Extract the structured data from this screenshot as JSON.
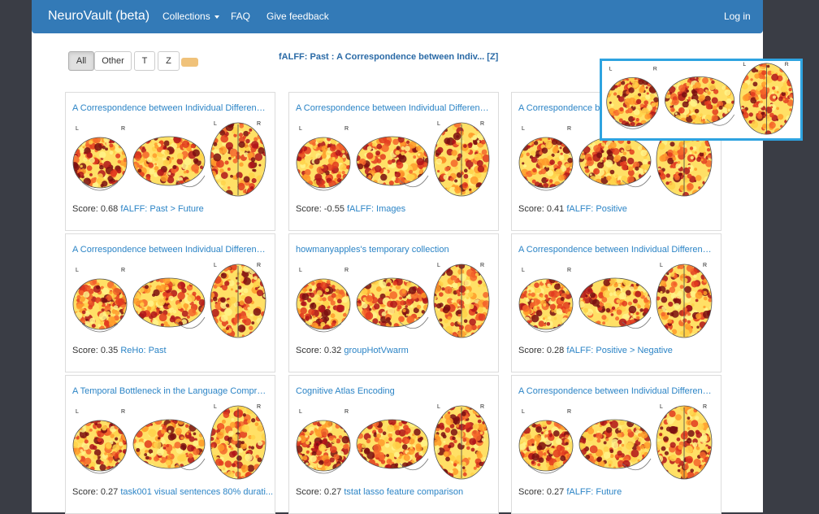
{
  "navbar": {
    "brand": "NeuroVault (beta)",
    "collections": "Collections",
    "faq": "FAQ",
    "feedback": "Give feedback",
    "login": "Log in"
  },
  "filters": {
    "all": "All",
    "other": "Other",
    "t": "T",
    "z": "Z"
  },
  "current_title": "fALFF: Past : A Correspondence between Indiv... [Z]",
  "brain_labels": {
    "left": "L",
    "right": "R"
  },
  "colors": {
    "nav": "#337ab7",
    "link": "#2b84c6",
    "highlight": "#2ea3e0",
    "slider": "#f0c27a"
  },
  "cards": [
    {
      "title": "A Correspondence between Individual Difference...",
      "score_label": "Score:",
      "score": "0.68",
      "map": "fALFF: Past > Future"
    },
    {
      "title": "A Correspondence between Individual Difference...",
      "score_label": "Score:",
      "score": "-0.55",
      "map": "fALFF: Images"
    },
    {
      "title": "A Correspondence between Individual Difference...",
      "score_label": "Score:",
      "score": "0.41",
      "map": "fALFF: Positive"
    },
    {
      "title": "A Correspondence between Individual Difference...",
      "score_label": "Score:",
      "score": "0.35",
      "map": "ReHo: Past"
    },
    {
      "title": "howmanyapples's temporary collection",
      "score_label": "Score:",
      "score": "0.32",
      "map": "groupHotVwarm"
    },
    {
      "title": "A Correspondence between Individual Difference...",
      "score_label": "Score:",
      "score": "0.28",
      "map": "fALFF: Positive > Negative"
    },
    {
      "title": "A Temporal Bottleneck in the Language Compreh...",
      "score_label": "Score:",
      "score": "0.27",
      "map": "task001 visual sentences 80% durati..."
    },
    {
      "title": "Cognitive Atlas Encoding",
      "score_label": "Score:",
      "score": "0.27",
      "map": "tstat lasso feature comparison"
    },
    {
      "title": "A Correspondence between Individual Difference...",
      "score_label": "Score:",
      "score": "0.27",
      "map": "fALFF: Future"
    }
  ]
}
